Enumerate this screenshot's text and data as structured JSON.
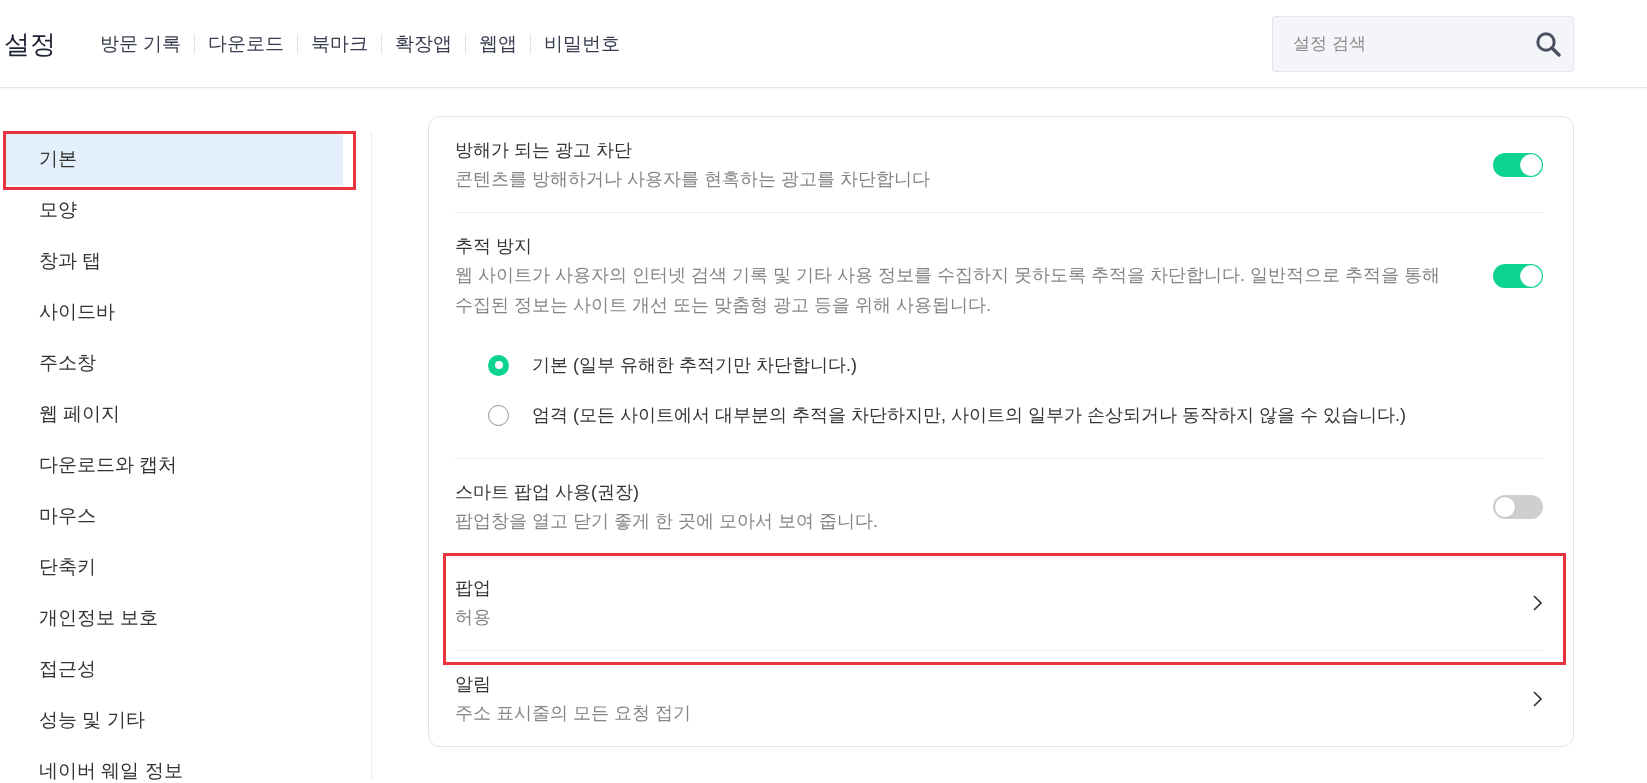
{
  "header": {
    "title": "설정",
    "nav": [
      "방문 기록",
      "다운로드",
      "북마크",
      "확장앱",
      "웹앱",
      "비밀번호"
    ],
    "search": {
      "placeholder": "설정 검색"
    }
  },
  "sidebar": {
    "items": [
      {
        "label": "기본",
        "selected": true,
        "highlighted": true
      },
      {
        "label": "모양",
        "selected": false,
        "highlighted": false
      },
      {
        "label": "창과 탭",
        "selected": false,
        "highlighted": false
      },
      {
        "label": "사이드바",
        "selected": false,
        "highlighted": false
      },
      {
        "label": "주소창",
        "selected": false,
        "highlighted": false
      },
      {
        "label": "웹 페이지",
        "selected": false,
        "highlighted": false
      },
      {
        "label": "다운로드와 캡처",
        "selected": false,
        "highlighted": false
      },
      {
        "label": "마우스",
        "selected": false,
        "highlighted": false
      },
      {
        "label": "단축키",
        "selected": false,
        "highlighted": false
      },
      {
        "label": "개인정보 보호",
        "selected": false,
        "highlighted": false
      },
      {
        "label": "접근성",
        "selected": false,
        "highlighted": false
      },
      {
        "label": "성능 및 기타",
        "selected": false,
        "highlighted": false
      },
      {
        "label": "네이버 웨일 정보",
        "selected": false,
        "highlighted": false
      }
    ]
  },
  "settings": {
    "rows": [
      {
        "kind": "toggle",
        "title": "방해가 되는 광고 차단",
        "description": "콘텐츠를 방해하거나 사용자를 현혹하는 광고를 차단합니다",
        "on": true,
        "highlighted": false
      },
      {
        "kind": "toggle",
        "title": "추적 방지",
        "description": "웹 사이트가 사용자의 인터넷 검색 기록 및 기타 사용 정보를 수집하지 못하도록 추적을 차단합니다. 일반적으로 추적을 통해 수집된 정보는 사이트 개선 또는 맞춤형 광고 등을 위해 사용됩니다.",
        "on": true,
        "highlighted": false,
        "options": [
          {
            "label": "기본 (일부 유해한 추적기만 차단합니다.)",
            "selected": true
          },
          {
            "label": "엄격 (모든 사이트에서 대부분의 추적을 차단하지만, 사이트의 일부가 손상되거나 동작하지 않을 수 있습니다.)",
            "selected": false
          }
        ]
      },
      {
        "kind": "toggle",
        "title": "스마트 팝업 사용(권장)",
        "description": "팝업창을 열고 닫기 좋게 한 곳에 모아서 보여 줍니다.",
        "on": false,
        "highlighted": false
      },
      {
        "kind": "link",
        "title": "팝업",
        "description": "허용",
        "highlighted": true
      },
      {
        "kind": "link",
        "title": "알림",
        "description": "주소 표시줄의 모든 요청 접기",
        "highlighted": false
      }
    ]
  }
}
